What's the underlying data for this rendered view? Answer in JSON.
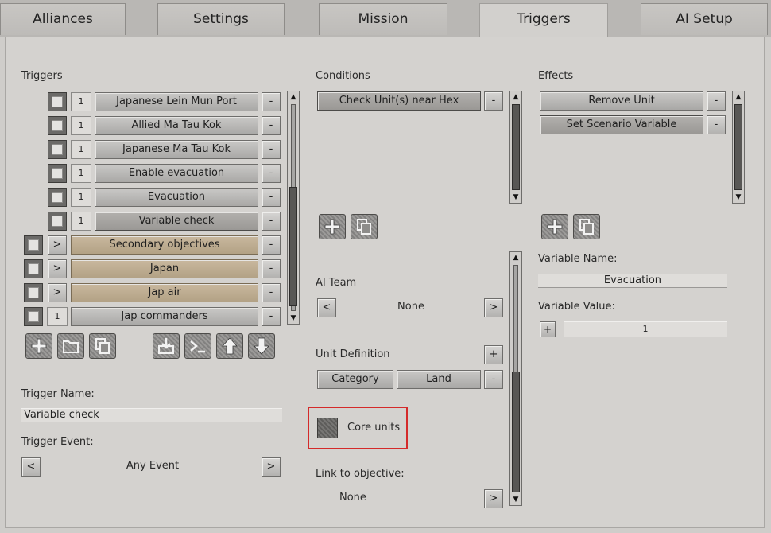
{
  "tabs": [
    {
      "label": "Alliances"
    },
    {
      "label": "Settings"
    },
    {
      "label": "Mission"
    },
    {
      "label": "Triggers"
    },
    {
      "label": "AI Setup"
    }
  ],
  "triggers": {
    "heading": "Triggers",
    "items": [
      {
        "count": "1",
        "label": "Japanese Lein Mun Port"
      },
      {
        "count": "1",
        "label": "Allied Ma Tau Kok"
      },
      {
        "count": "1",
        "label": "Japanese Ma Tau Kok"
      },
      {
        "count": "1",
        "label": "Enable evacuation"
      },
      {
        "count": "1",
        "label": "Evacuation"
      },
      {
        "count": "1",
        "label": "Variable check"
      }
    ],
    "groups": [
      {
        "expand": ">",
        "label": "Secondary objectives"
      },
      {
        "expand": ">",
        "label": "Japan"
      },
      {
        "expand": ">",
        "label": "Jap air"
      },
      {
        "expand": "1",
        "label": "Jap commanders"
      }
    ],
    "remove_label": "-",
    "name_label": "Trigger Name:",
    "name_value": "Variable check",
    "event_label": "Trigger Event:",
    "event_value": "Any Event",
    "prev": "<",
    "next": ">"
  },
  "conditions": {
    "heading": "Conditions",
    "items": [
      {
        "label": "Check Unit(s) near Hex"
      }
    ],
    "remove_label": "-",
    "ai_team_label": "AI Team",
    "ai_team_value": "None",
    "unit_def_label": "Unit Definition",
    "add": "+",
    "category": "Category",
    "category_value": "Land",
    "core_units": "Core units",
    "link_label": "Link to objective:",
    "link_value": "None",
    "prev": "<",
    "next": ">"
  },
  "effects": {
    "heading": "Effects",
    "items": [
      {
        "label": "Remove Unit"
      },
      {
        "label": "Set Scenario Variable"
      }
    ],
    "remove_label": "-",
    "var_name_label": "Variable Name:",
    "var_name_value": "Evacuation",
    "var_value_label": "Variable Value:",
    "var_value": "1",
    "add": "+"
  },
  "scroll": {
    "up": "▲",
    "down": "▼"
  }
}
